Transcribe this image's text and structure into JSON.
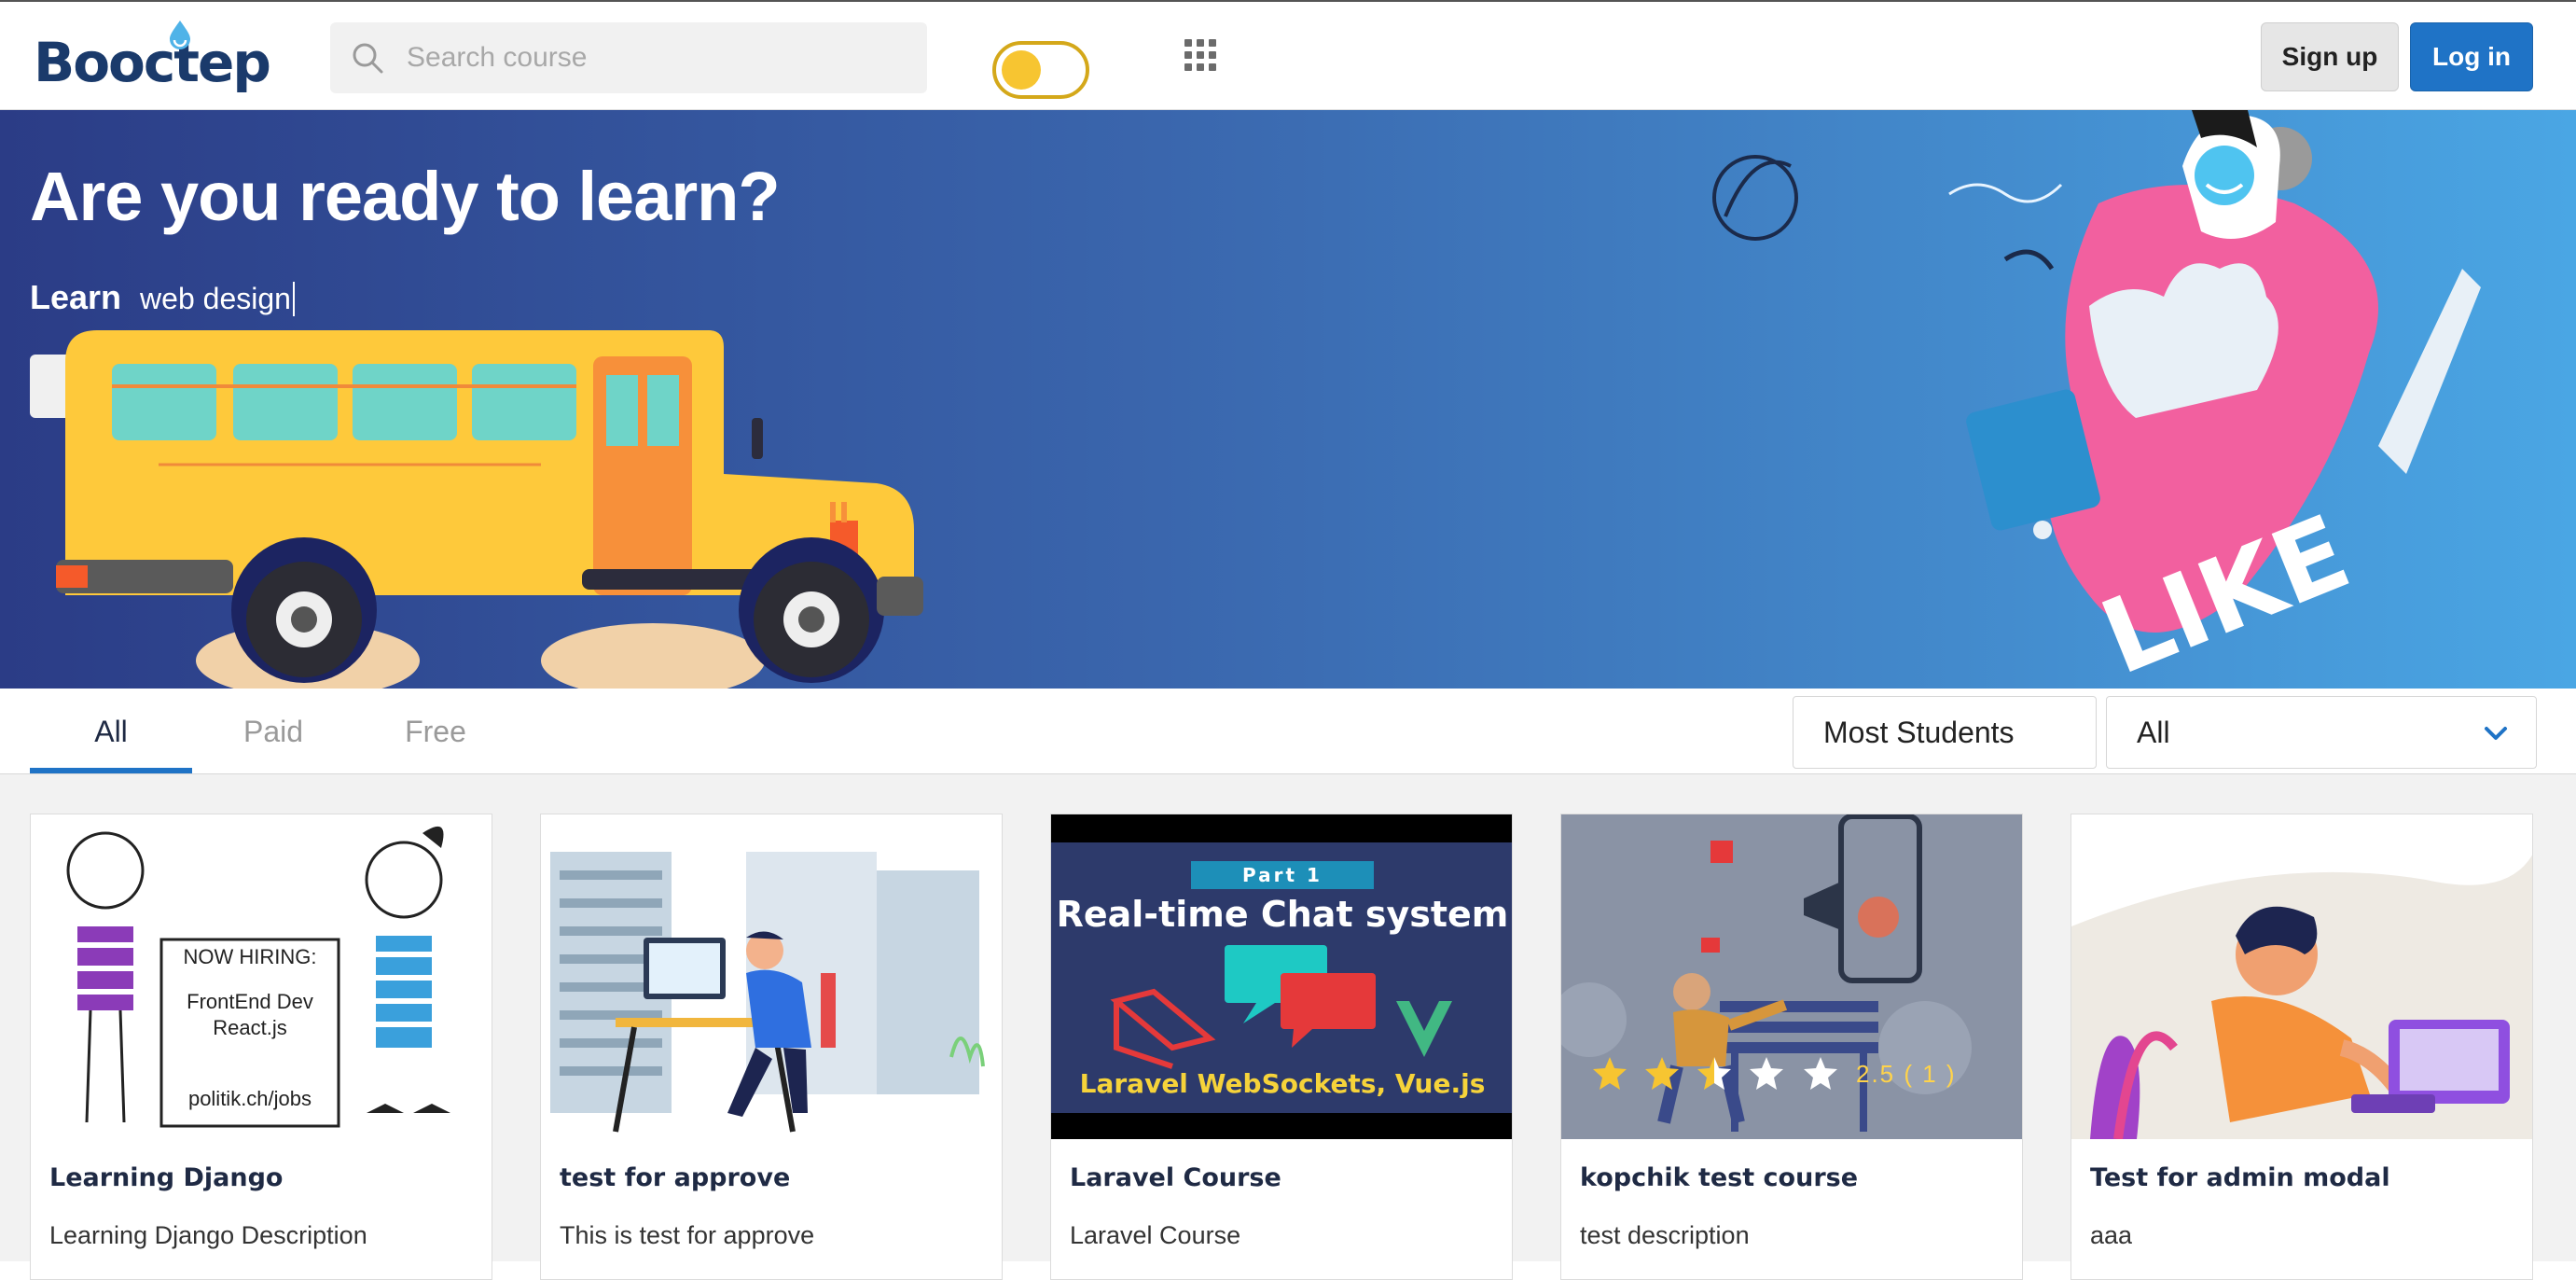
{
  "header": {
    "logo_text": "Booctep",
    "search_placeholder": "Search course",
    "signup_label": "Sign up",
    "login_label": "Log in"
  },
  "hero": {
    "title": "Are you ready to learn?",
    "learn_label": "Learn",
    "learn_value": "web design",
    "like_text": "LIKE"
  },
  "filters": {
    "tabs": [
      {
        "label": "All",
        "active": true
      },
      {
        "label": "Paid",
        "active": false
      },
      {
        "label": "Free",
        "active": false
      }
    ],
    "sort_selected": "Most Students",
    "category_selected": "All"
  },
  "courses": [
    {
      "title": "Learning Django",
      "description": "Learning Django Description",
      "thumb_text": [
        "NOW HIRING:",
        "FrontEnd Dev",
        "React.js",
        "politik.ch/jobs"
      ]
    },
    {
      "title": "test for approve",
      "description": "This is test for approve"
    },
    {
      "title": "Laravel Course",
      "description": "Laravel Course",
      "thumb_text": [
        "Part 1",
        "Real-time Chat system",
        "Laravel WebSockets, Vue.js"
      ]
    },
    {
      "title": "kopchik test course",
      "description": "test description",
      "rating": {
        "stars": 2.5,
        "text": "2.5 ( 1 )"
      }
    },
    {
      "title": "Test for admin modal",
      "description": "aaa"
    }
  ],
  "colors": {
    "brand": "#1a3a6b",
    "accent_blue": "#1f73c6",
    "toggle_yellow": "#f7c531",
    "hero_start": "#2b3c86",
    "hero_end": "#4aa6e4"
  }
}
